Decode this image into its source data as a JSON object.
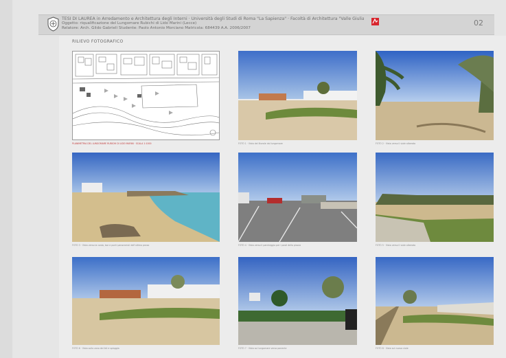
{
  "header": {
    "line1": "TESI DI LAUREA  in Arredamento e Architettura degli Interni · Università degli Studi di Roma \"La Sapienza\" · Facoltà di Architettura \"Valle Giulia\"",
    "line2": "Oggetto: riqualificazione del Lungomare Rubichi di Lido Marini (Lecce)",
    "line3": "Relatore: Arch. Gildo Gabrieli      Studente: Paolo Antonio Morciano   Matricola: 684439   A.A. 2006/2007",
    "page_number": "02"
  },
  "section_title": "RILIEVO FOTOGRAFICO",
  "captions": {
    "map": "PLANIMETRIA DEL LUNGOMARE RUBICHI DI LIDO MARINI · SCALA 1:1000",
    "p1": "FOTO 1 · Vista del litorale dal lungomare",
    "p2": "FOTO 2 · Vista verso il viale alberato",
    "p3": "FOTO 3 · Vista verso la costa, bar e punti panoramici dell'ultimo pezzo",
    "p4": "FOTO 4 · Vista verso il parcheggio per i posti della piazza",
    "p5": "FOTO 5 · Vista verso il viale alberato",
    "p6": "FOTO 6 · Vista sulla zona dei lidi e spiaggia",
    "p7": "FOTO 7 · Vista sul lungomare verso ponente",
    "p8": "FOTO 8 · Vista sul nuovo viale"
  },
  "colors": {
    "accent_red": "#d8262e",
    "header_bg": "#d4d4d4",
    "page_bg": "#e6e6e6"
  }
}
